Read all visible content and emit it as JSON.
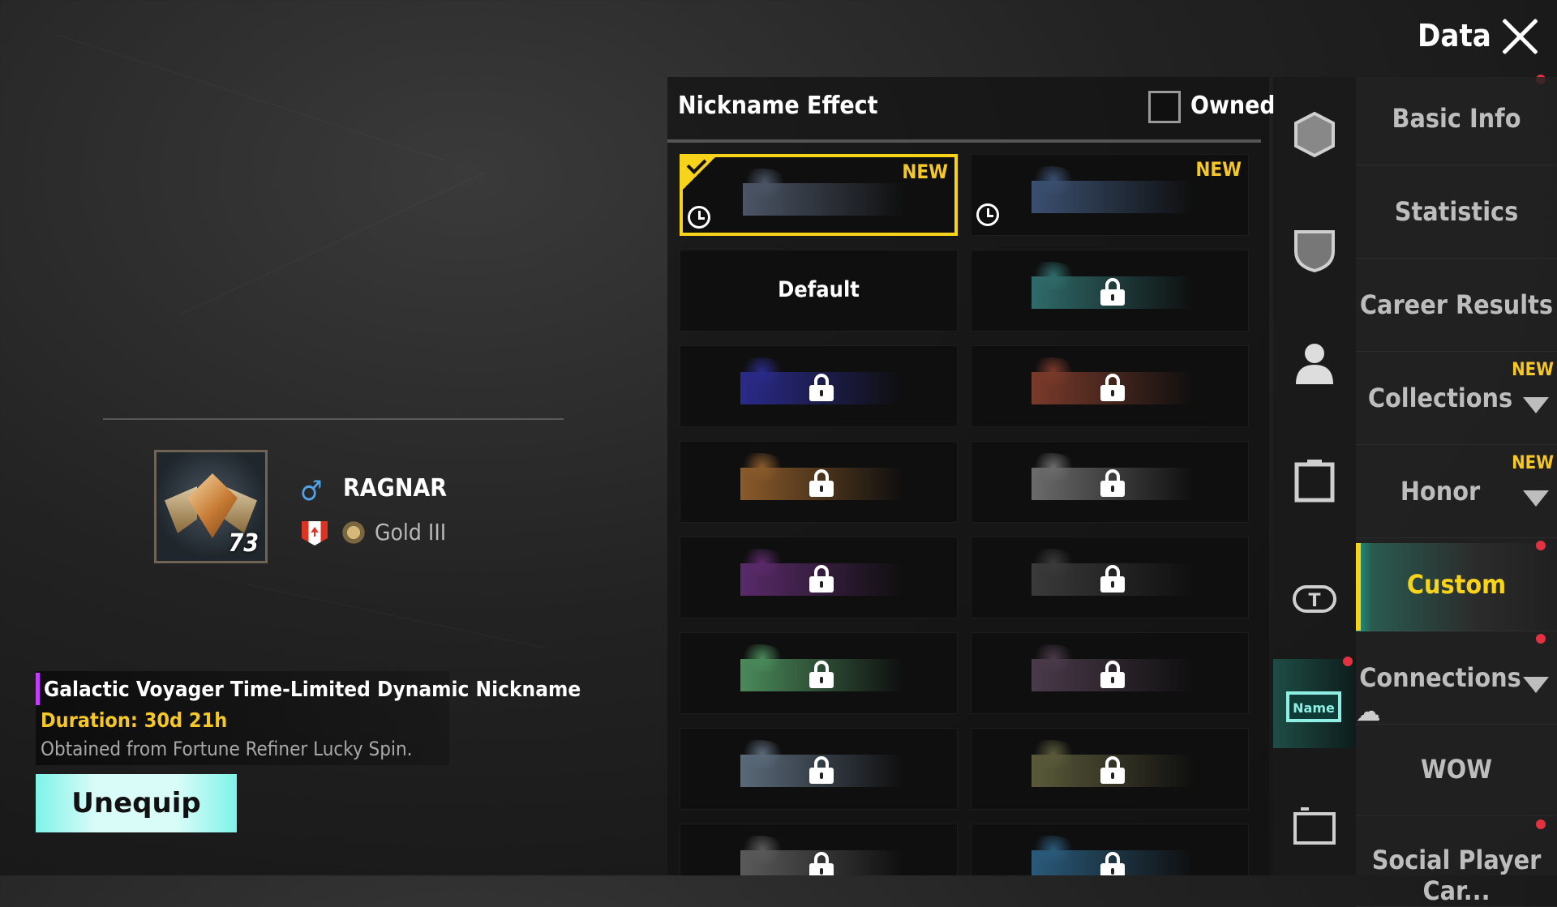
{
  "header": {
    "title": "Data"
  },
  "profile": {
    "level": "73",
    "name": "RAGNAR",
    "rank": "Gold III"
  },
  "item": {
    "name": "Galactic Voyager Time-Limited Dynamic Nickname",
    "duration": "Duration: 30d 21h",
    "source": "Obtained from Fortune Refiner Lucky Spin.",
    "button": "Unequip"
  },
  "panel": {
    "title": "Nickname Effect",
    "filter_label": "Owned"
  },
  "cells": [
    {
      "label": "",
      "new": "NEW",
      "owned": true,
      "timed": true,
      "selected": true,
      "color": "#4b5566"
    },
    {
      "label": "",
      "new": "NEW",
      "owned": true,
      "timed": true,
      "selected": false,
      "color": "#3a5070"
    },
    {
      "label": "Default",
      "new": "",
      "owned": true,
      "timed": false,
      "selected": false,
      "color": ""
    },
    {
      "label": "",
      "new": "",
      "owned": false,
      "timed": false,
      "selected": false,
      "color": "#2f6b6a"
    },
    {
      "label": "",
      "new": "",
      "owned": false,
      "timed": false,
      "selected": false,
      "color": "#2a2a8a"
    },
    {
      "label": "",
      "new": "",
      "owned": false,
      "timed": false,
      "selected": false,
      "color": "#7a3a2a"
    },
    {
      "label": "",
      "new": "",
      "owned": false,
      "timed": false,
      "selected": false,
      "color": "#8a5a2a"
    },
    {
      "label": "",
      "new": "",
      "owned": false,
      "timed": false,
      "selected": false,
      "color": "#6b6b6b"
    },
    {
      "label": "",
      "new": "",
      "owned": false,
      "timed": false,
      "selected": false,
      "color": "#5a2a6a"
    },
    {
      "label": "",
      "new": "",
      "owned": false,
      "timed": false,
      "selected": false,
      "color": "#3a3a3a"
    },
    {
      "label": "",
      "new": "",
      "owned": false,
      "timed": false,
      "selected": false,
      "color": "#4a8a5a"
    },
    {
      "label": "",
      "new": "",
      "owned": false,
      "timed": false,
      "selected": false,
      "color": "#4a3a4a"
    },
    {
      "label": "",
      "new": "",
      "owned": false,
      "timed": false,
      "selected": false,
      "color": "#5a6a7a"
    },
    {
      "label": "",
      "new": "",
      "owned": false,
      "timed": false,
      "selected": false,
      "color": "#5a5a3a"
    },
    {
      "label": "",
      "new": "",
      "owned": false,
      "timed": false,
      "selected": false,
      "color": "#5a5a5a"
    },
    {
      "label": "",
      "new": "",
      "owned": false,
      "timed": false,
      "selected": false,
      "color": "#2a5a7a"
    }
  ],
  "icon_tabs": [
    {
      "name": "emblem-icon",
      "active": false
    },
    {
      "name": "shield-icon",
      "active": false
    },
    {
      "name": "avatar-icon",
      "active": false
    },
    {
      "name": "frame-icon",
      "active": false
    },
    {
      "name": "title-icon",
      "active": false
    },
    {
      "name": "nameplate-icon",
      "active": true,
      "text": "Name"
    },
    {
      "name": "card-icon",
      "active": false
    }
  ],
  "tabs": [
    {
      "label": "Basic Info",
      "new": "",
      "caret": false,
      "active": false
    },
    {
      "label": "Statistics",
      "new": "",
      "caret": false,
      "active": false
    },
    {
      "label": "Career Results",
      "new": "",
      "caret": false,
      "active": false
    },
    {
      "label": "Collections",
      "new": "NEW",
      "caret": true,
      "active": false
    },
    {
      "label": "Honor",
      "new": "NEW",
      "caret": true,
      "active": false
    },
    {
      "label": "Custom",
      "new": "",
      "caret": false,
      "active": true
    },
    {
      "label": "Connections",
      "new": "",
      "caret": true,
      "active": false
    },
    {
      "label": "WOW",
      "new": "",
      "caret": false,
      "active": false
    },
    {
      "label": "Social Player Car...",
      "new": "",
      "caret": false,
      "active": false
    }
  ],
  "colors": {
    "accent": "#f7d31a",
    "active_tab_teal": "#1c9b86",
    "unequip": "#9ef5ec",
    "rarity_purple": "#c63dff",
    "duration": "#f5c828",
    "notification": "#e23140"
  }
}
